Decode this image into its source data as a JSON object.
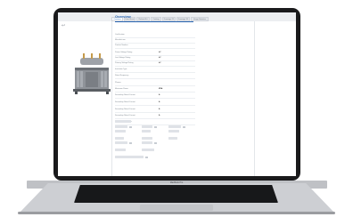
{
  "device": {
    "brand_label": "MacBook Pro"
  },
  "tabs": [
    {
      "label": "Overview",
      "active": true
    },
    {
      "label": "Data Sheet",
      "active": false
    },
    {
      "label": "Related Kit",
      "active": false
    },
    {
      "label": "Catalog",
      "active": false
    },
    {
      "label": "Drawings 2D",
      "active": false
    },
    {
      "label": "Drawings 3D",
      "active": false
    },
    {
      "label": "Usage Statistics",
      "active": false
    }
  ],
  "page": {
    "heading": "Overview",
    "back_icon": "back-arrow-icon"
  },
  "product": {
    "image_icon": "transformer-image"
  },
  "specs": [
    {
      "label": "Certification",
      "value": ""
    },
    {
      "label": "Manufacturer",
      "value": ""
    },
    {
      "label": "Product Number",
      "value": ""
    },
    {
      "label": "Power Voltage Rating",
      "value": "kV"
    },
    {
      "label": "Low Voltage Rating",
      "value": "kV"
    },
    {
      "label": "Primary Voltage Rating",
      "value": "kV"
    },
    {
      "label": "Insulation Type",
      "value": ""
    },
    {
      "label": "Rated Frequency",
      "value": ""
    },
    {
      "label": "Phases",
      "value": ""
    },
    {
      "label": "Maximum Power",
      "value": "MVA"
    },
    {
      "label": "Secondary Rated Current",
      "value": "A"
    },
    {
      "label": "Secondary Rated Current",
      "value": "A"
    },
    {
      "label": "Secondary Rated Current",
      "value": "A"
    },
    {
      "label": "Secondary Rated Current",
      "value": "A"
    },
    {
      "label": "Minimum Load Class",
      "value": ""
    }
  ],
  "colors": {
    "accent": "#2a66b3",
    "frame": "#1a1a1c",
    "tab_background": "#eceef1"
  }
}
